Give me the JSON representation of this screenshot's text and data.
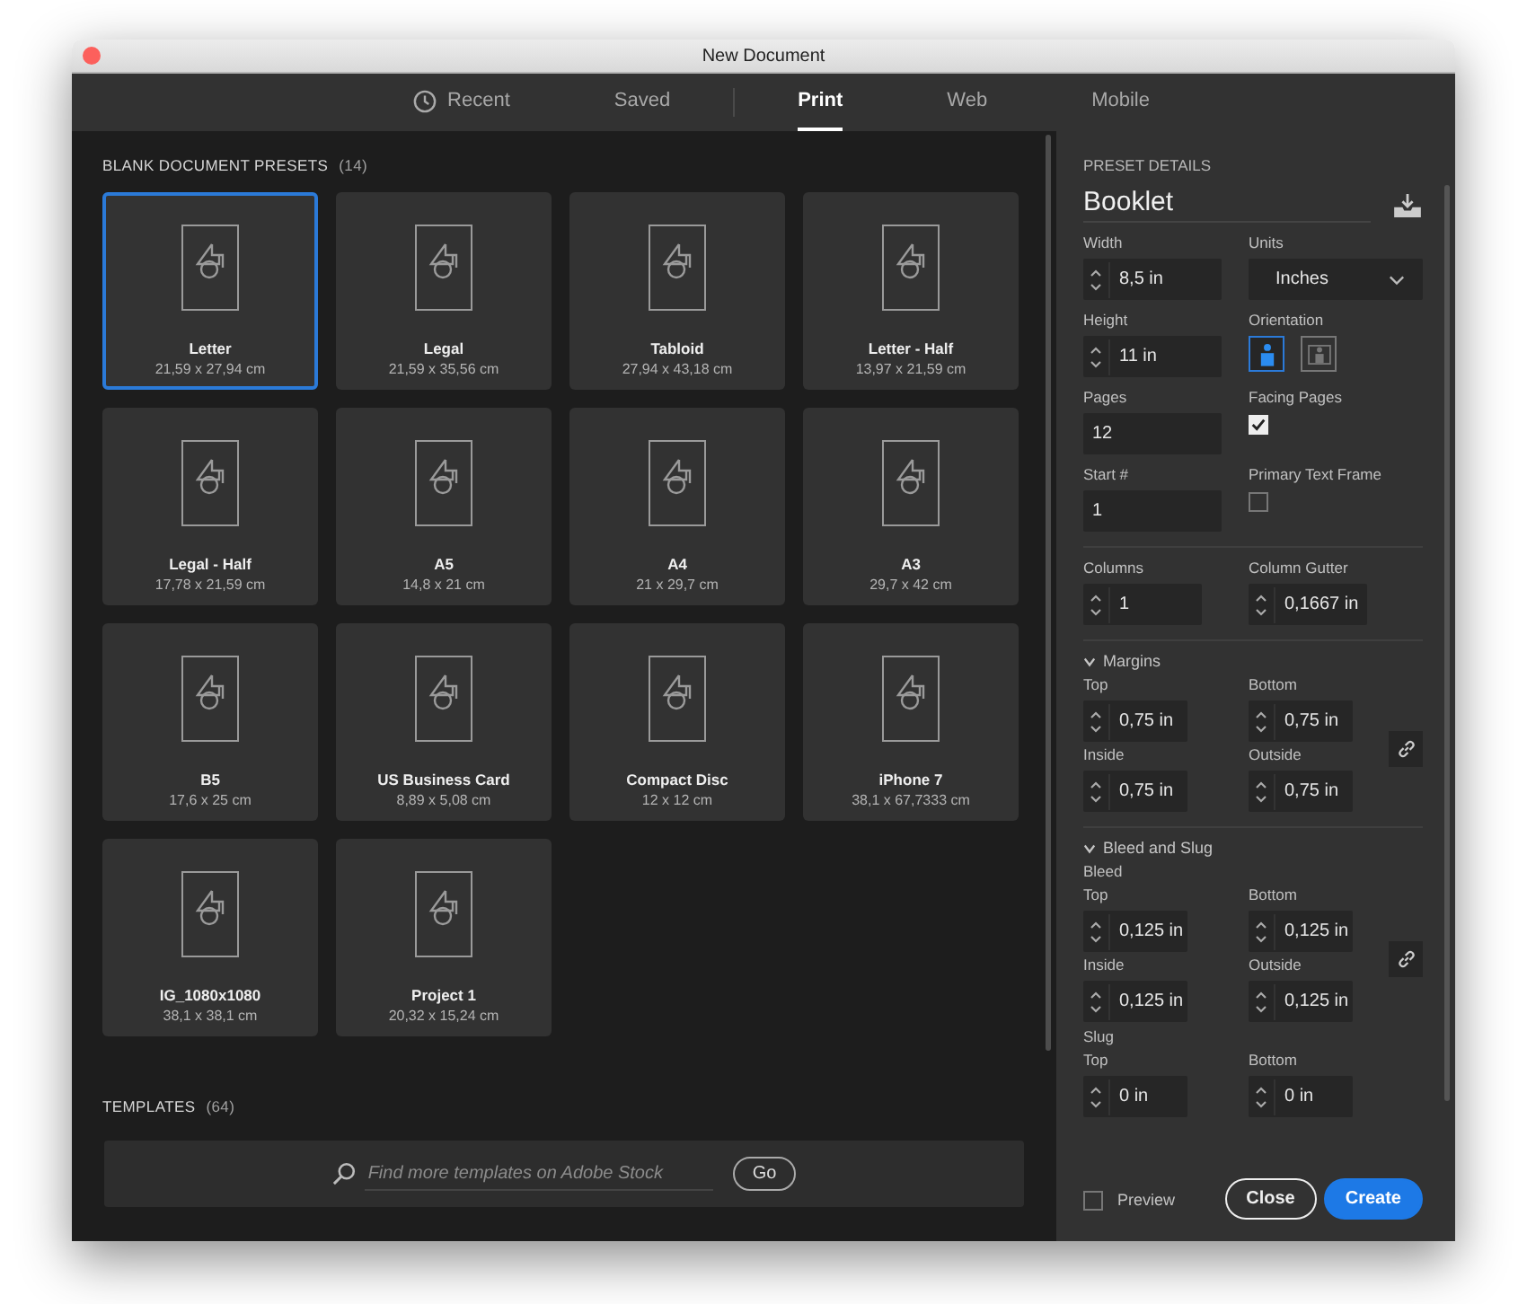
{
  "window": {
    "title": "New Document"
  },
  "tab_groups": [
    [
      {
        "label": "Recent",
        "kind": "icon",
        "selected": false
      },
      {
        "label": "Saved",
        "kind": "text",
        "selected": false
      }
    ],
    [
      {
        "label": "Print",
        "kind": "text",
        "selected": true
      },
      {
        "label": "Web",
        "kind": "text",
        "selected": false
      },
      {
        "label": "Mobile",
        "kind": "text",
        "selected": false
      }
    ]
  ],
  "presets": {
    "title": "BLANK DOCUMENT PRESETS",
    "count": "(14)",
    "items": [
      {
        "name": "Letter",
        "size": "21,59 x 27,94 cm",
        "selected": true
      },
      {
        "name": "Legal",
        "size": "21,59 x 35,56 cm",
        "selected": false
      },
      {
        "name": "Tabloid",
        "size": "27,94 x 43,18 cm",
        "selected": false
      },
      {
        "name": "Letter - Half",
        "size": "13,97 x 21,59 cm",
        "selected": false
      },
      {
        "name": "Legal - Half",
        "size": "17,78 x 21,59 cm",
        "selected": false
      },
      {
        "name": "A5",
        "size": "14,8 x 21 cm",
        "selected": false
      },
      {
        "name": "A4",
        "size": "21 x 29,7 cm",
        "selected": false
      },
      {
        "name": "A3",
        "size": "29,7 x 42 cm",
        "selected": false
      },
      {
        "name": "B5",
        "size": "17,6 x 25 cm",
        "selected": false
      },
      {
        "name": "US Business Card",
        "size": "8,89 x 5,08 cm",
        "selected": false
      },
      {
        "name": "Compact Disc",
        "size": "12 x 12 cm",
        "selected": false
      },
      {
        "name": "iPhone 7",
        "size": "38,1 x 67,7333 cm",
        "selected": false
      },
      {
        "name": "IG_1080x1080",
        "size": "38,1 x 38,1 cm",
        "selected": false
      },
      {
        "name": "Project 1",
        "size": "20,32 x 15,24 cm",
        "selected": false
      }
    ]
  },
  "templates": {
    "title": "TEMPLATES",
    "count": "(64)",
    "search": {
      "placeholder": "Find more templates on Adobe Stock"
    },
    "button": "Go"
  },
  "details": {
    "heading": "PRESET DETAILS",
    "name": "Booklet",
    "width": {
      "label": "Width",
      "value": "8,5 in",
      "stepper": true
    },
    "units": {
      "label": "Units",
      "value": "Inches"
    },
    "height": {
      "label": "Height",
      "value": "11 in",
      "stepper": true
    },
    "orientation": {
      "label": "Orientation",
      "options": [
        {
          "kind": "portrait",
          "selected": true
        },
        {
          "kind": "landscape",
          "selected": false
        }
      ]
    },
    "pages": {
      "label": "Pages",
      "value": "12",
      "stepper": false
    },
    "facing_pages": {
      "label": "Facing Pages",
      "checked": true
    },
    "start": {
      "label": "Start #",
      "value": "1",
      "stepper": false
    },
    "primary_text_frame": {
      "label": "Primary Text Frame",
      "checked": false
    },
    "columns": {
      "label": "Columns",
      "value": "1",
      "stepper": true
    },
    "column_gutter": {
      "label": "Column Gutter",
      "value": "0,1667 in",
      "stepper": true
    },
    "margins": {
      "title": "Margins",
      "expanded": true,
      "fields": [
        {
          "label": "Top",
          "value": "0,75 in"
        },
        {
          "label": "Bottom",
          "value": "0,75 in"
        },
        {
          "label": "Inside",
          "value": "0,75 in"
        },
        {
          "label": "Outside",
          "value": "0,75 in"
        }
      ]
    },
    "bleed_and_slug": {
      "title": "Bleed and Slug",
      "expanded": true,
      "bleed_label": "Bleed",
      "bleed": [
        {
          "label": "Top",
          "value": "0,125 in"
        },
        {
          "label": "Bottom",
          "value": "0,125 in"
        },
        {
          "label": "Inside",
          "value": "0,125 in"
        },
        {
          "label": "Outside",
          "value": "0,125 in"
        }
      ],
      "slug_label": "Slug",
      "slug": [
        {
          "label": "Top",
          "value": "0 in"
        },
        {
          "label": "Bottom",
          "value": "0 in"
        }
      ]
    }
  },
  "footer": {
    "preview": {
      "label": "Preview",
      "checked": false
    },
    "buttons": [
      {
        "label": "Close",
        "kind": "secondary"
      },
      {
        "label": "Create",
        "kind": "primary"
      }
    ]
  }
}
